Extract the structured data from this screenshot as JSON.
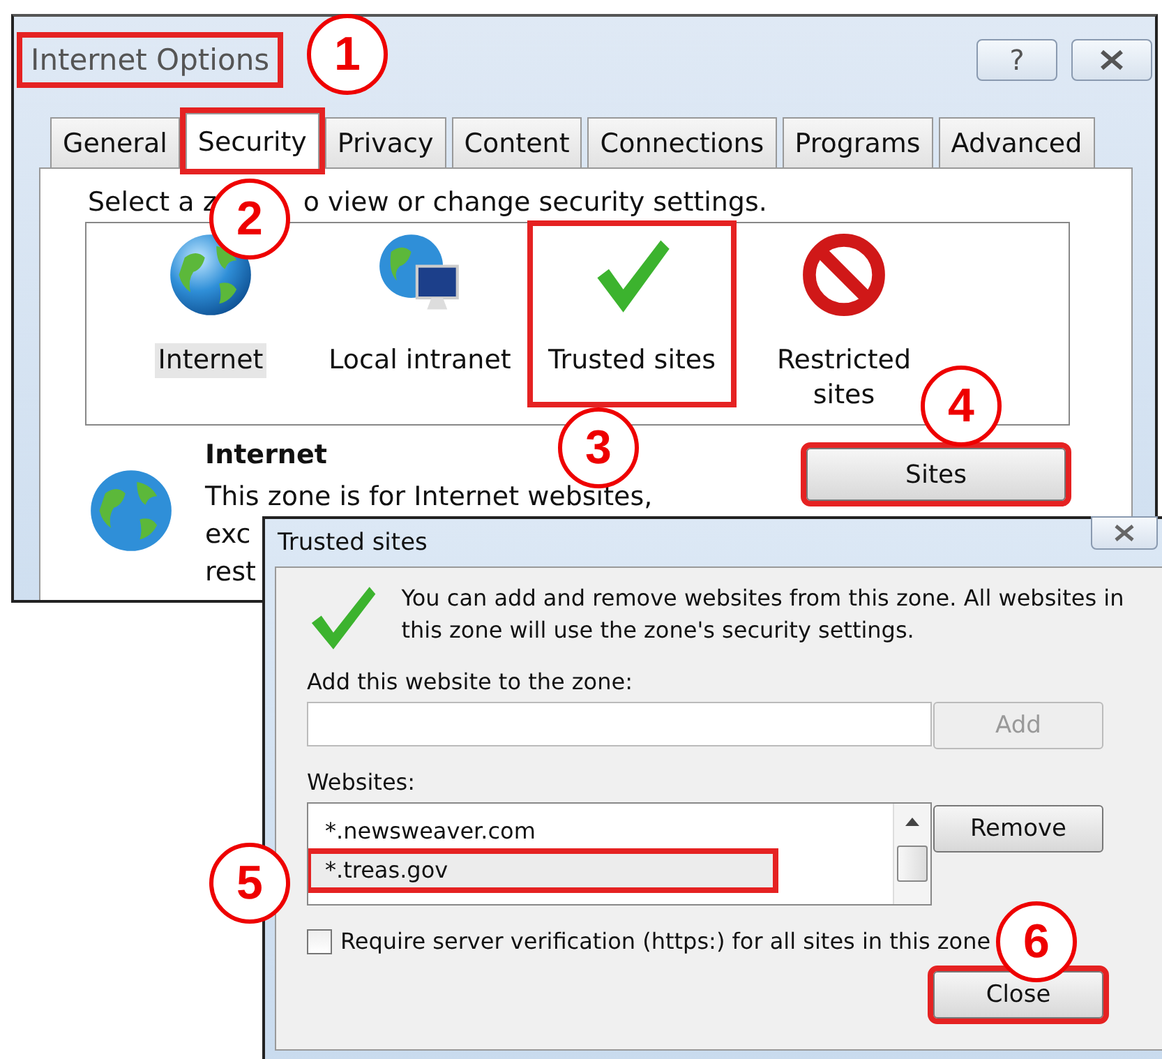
{
  "window": {
    "title": "Internet Options",
    "title_highlighted": true,
    "help_button": "?"
  },
  "tabs": [
    {
      "label": "General",
      "selected": false,
      "highlighted": false
    },
    {
      "label": "Security",
      "selected": true,
      "highlighted": true
    },
    {
      "label": "Privacy",
      "selected": false,
      "highlighted": false
    },
    {
      "label": "Content",
      "selected": false,
      "highlighted": false
    },
    {
      "label": "Connections",
      "selected": false,
      "highlighted": false
    },
    {
      "label": "Programs",
      "selected": false,
      "highlighted": false
    },
    {
      "label": "Advanced",
      "selected": false,
      "highlighted": false
    }
  ],
  "instruction": [
    "Select a z",
    "o view or change security settings."
  ],
  "zones": [
    {
      "kind": "globe",
      "label": "Internet",
      "selected": true,
      "highlighted": false
    },
    {
      "kind": "intranet",
      "label": "Local intranet",
      "selected": false,
      "highlighted": false
    },
    {
      "kind": "trusted",
      "label": "Trusted sites",
      "selected": false,
      "highlighted": true
    },
    {
      "kind": "restricted",
      "label": "Restricted sites",
      "selected": false,
      "highlighted": false
    }
  ],
  "zone_detail": {
    "title": "Internet",
    "lines": [
      "This zone is for Internet websites,",
      "exc",
      "rest"
    ]
  },
  "sites_button": {
    "label": "Sites",
    "highlighted": true
  },
  "dialog": {
    "title": "Trusted sites",
    "message": "You can add and remove websites from this zone. All websites in this zone will use the zone's security settings.",
    "add_label": "Add this website to the zone:",
    "add_button": {
      "label": "Add",
      "disabled": true
    },
    "websites_label": "Websites:",
    "websites": [
      {
        "text": "*.newsweaver.com",
        "selected": false,
        "highlighted": false
      },
      {
        "text": "*.treas.gov",
        "selected": true,
        "highlighted": true
      }
    ],
    "remove_button": "Remove",
    "verify": {
      "label": "Require server verification (https:) for all sites in this zone",
      "checked": false
    },
    "close_button": {
      "label": "Close",
      "highlighted": true
    }
  },
  "callouts": [
    "1",
    "2",
    "3",
    "4",
    "5",
    "6"
  ]
}
